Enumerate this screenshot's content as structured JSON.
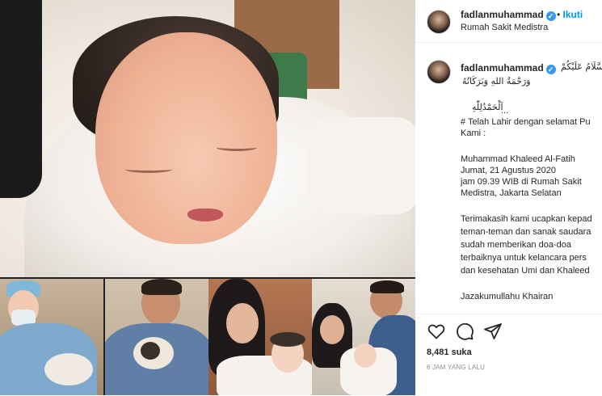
{
  "post": {
    "username": "fadlanmuhammad",
    "follow_label": "Ikuti",
    "follow_separator": "•",
    "location": "Rumah Sakit Medistra",
    "verified_mark": "✓"
  },
  "caption": {
    "username": "fadlanmuhammad",
    "arabic_line1": "السَّلَامُ عَلَيْكُمْ",
    "arabic_line2": "وَرَحْمَةُ اللهِ وَبَرَكَاتُهُ",
    "arabic_alhamdulillah": "اَلْحَمْدُلِلّٰهِ",
    "ellipsis": "...",
    "lines": [
      "# Telah Lahir dengan selamat Pu",
      "Kami :",
      "",
      "Muhammad Khaleed Al-Fatih",
      "Jumat, 21 Agustus 2020",
      "jam 09.39 WIB di Rumah Sakit",
      "Medistra, Jakarta Selatan",
      "",
      "Terimakasih kami ucapkan kepad",
      "teman-teman dan sanak saudara",
      "sudah memberikan doa-doa",
      "terbaiknya untuk kelancara pers",
      "dan kesehatan Umi dan Khaleed",
      "",
      "Jazakumullahu Khairan"
    ]
  },
  "engagement": {
    "likes": "8,481 suka",
    "timestamp": "6 JAM YANG LALU"
  },
  "icons": {
    "like": "heart-icon",
    "comment": "comment-icon",
    "share": "share-icon"
  },
  "colors": {
    "link_blue": "#0095f6",
    "verified_blue": "#3897f0",
    "text": "#262626",
    "muted": "#8e8e8e"
  }
}
